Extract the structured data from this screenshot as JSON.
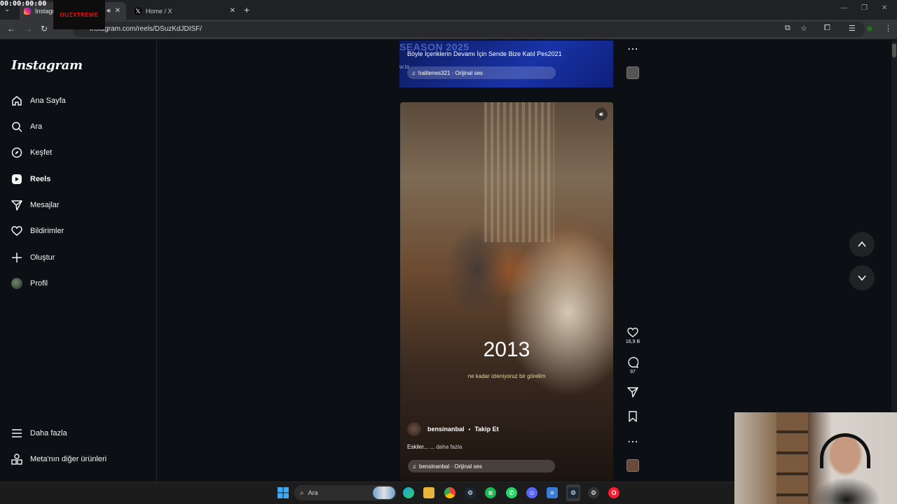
{
  "recording": {
    "timer": "00:00:00:00",
    "overlay_logo": "OUZXTREME"
  },
  "browser": {
    "tabs": [
      {
        "label": "Instagram",
        "active": true
      },
      {
        "label": "Home / X",
        "active": false
      }
    ],
    "url": "instagram.com/reels/DSuzKdJDISF/"
  },
  "sidebar": {
    "logo": "Instagram",
    "items": [
      {
        "label": "Ana Sayfa",
        "icon": "home-icon"
      },
      {
        "label": "Ara",
        "icon": "search-icon"
      },
      {
        "label": "Keşfet",
        "icon": "compass-icon"
      },
      {
        "label": "Reels",
        "icon": "reels-icon"
      },
      {
        "label": "Mesajlar",
        "icon": "send-icon"
      },
      {
        "label": "Bildirimler",
        "icon": "heart-icon"
      },
      {
        "label": "Oluştur",
        "icon": "plus-icon"
      },
      {
        "label": "Profil",
        "icon": "avatar"
      }
    ],
    "bottom_items": [
      {
        "label": "Daha fazla",
        "icon": "menu-icon"
      },
      {
        "label": "Meta'nın diğer ürünleri",
        "icon": "apps-icon"
      }
    ]
  },
  "previous_reel": {
    "overlay_text": "SEASON 2025",
    "caption": "Böyle İçeriklerin Devamı İçin Sende Bize Katıl Pes2021",
    "url_fragment": "w.ta",
    "audio": "halitenes321 · Orijinal ses"
  },
  "current_reel": {
    "year_text": "2013",
    "subtitle": "ne kadar izleniyoruz bir görelim",
    "author": "bensinanbal",
    "follow_label": "Takip Et",
    "description": "Eskiler... ...",
    "more_label": "daha fazla",
    "audio": "bensinanbal · Orijinal ses",
    "likes": "16,9 B",
    "comments": "97"
  },
  "taskbar": {
    "search_label": "Ara",
    "icons": [
      "windows-icon",
      "search-icon",
      "edge-icon",
      "folder-icon",
      "chrome-icon",
      "steam-icon",
      "spotify-icon",
      "whatsapp-icon",
      "discord-icon",
      "notepad-icon",
      "steam-icon",
      "settings-icon",
      "opera-icon"
    ]
  },
  "colors": {
    "background": "#0c1014",
    "accent": "#f5f5f5",
    "taskbar": "#1c1c1c"
  }
}
